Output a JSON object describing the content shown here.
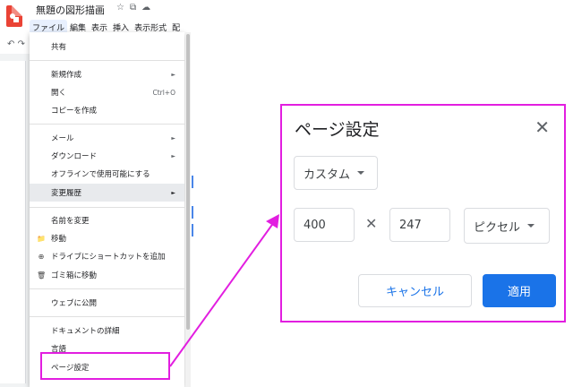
{
  "app": {
    "doc_title": "無題の図形描画",
    "title_icons": [
      "☆",
      "⧉",
      "☁"
    ],
    "menubar": [
      "ファイル",
      "編集",
      "表示",
      "挿入",
      "表示形式",
      "配"
    ],
    "toolbar_icons": [
      "↶",
      "↷"
    ]
  },
  "file_menu": {
    "items": [
      {
        "label": "共有",
        "icon": "",
        "shortcut": "",
        "submenu": false
      },
      {
        "label": "新規作成",
        "icon": "",
        "shortcut": "",
        "submenu": true
      },
      {
        "label": "開く",
        "icon": "",
        "shortcut": "Ctrl+O",
        "submenu": false
      },
      {
        "label": "コピーを作成",
        "icon": "",
        "shortcut": "",
        "submenu": false
      },
      {
        "label": "メール",
        "icon": "",
        "shortcut": "",
        "submenu": true
      },
      {
        "label": "ダウンロード",
        "icon": "",
        "shortcut": "",
        "submenu": true
      },
      {
        "label": "オフラインで使用可能にする",
        "icon": "",
        "shortcut": "",
        "submenu": false
      },
      {
        "label": "変更履歴",
        "icon": "",
        "shortcut": "",
        "submenu": true
      },
      {
        "label": "名前を変更",
        "icon": "",
        "shortcut": "",
        "submenu": false
      },
      {
        "label": "移動",
        "icon": "📁",
        "shortcut": "",
        "submenu": false
      },
      {
        "label": "ドライブにショートカットを追加",
        "icon": "⊕",
        "shortcut": "",
        "submenu": false
      },
      {
        "label": "ゴミ箱に移動",
        "icon": "🗑",
        "shortcut": "",
        "submenu": false
      },
      {
        "label": "ウェブに公開",
        "icon": "",
        "shortcut": "",
        "submenu": false
      },
      {
        "label": "ドキュメントの詳細",
        "icon": "",
        "shortcut": "",
        "submenu": false
      },
      {
        "label": "言語",
        "icon": "",
        "shortcut": "",
        "submenu": false
      },
      {
        "label": "ページ設定",
        "icon": "",
        "shortcut": "",
        "submenu": false
      }
    ],
    "highlighted": "変更履歴",
    "submenu_arrow": "►"
  },
  "page_setup": {
    "title": "ページ設定",
    "close_icon": "✕",
    "size_option": "カスタム",
    "width": "400",
    "times_symbol": "✕",
    "height": "247",
    "unit_option": "ピクセル",
    "cancel_label": "キャンセル",
    "apply_label": "適用"
  },
  "colors": {
    "annotation": "#e21ee0",
    "primary": "#1a73e8",
    "app_red": "#ea4335"
  }
}
